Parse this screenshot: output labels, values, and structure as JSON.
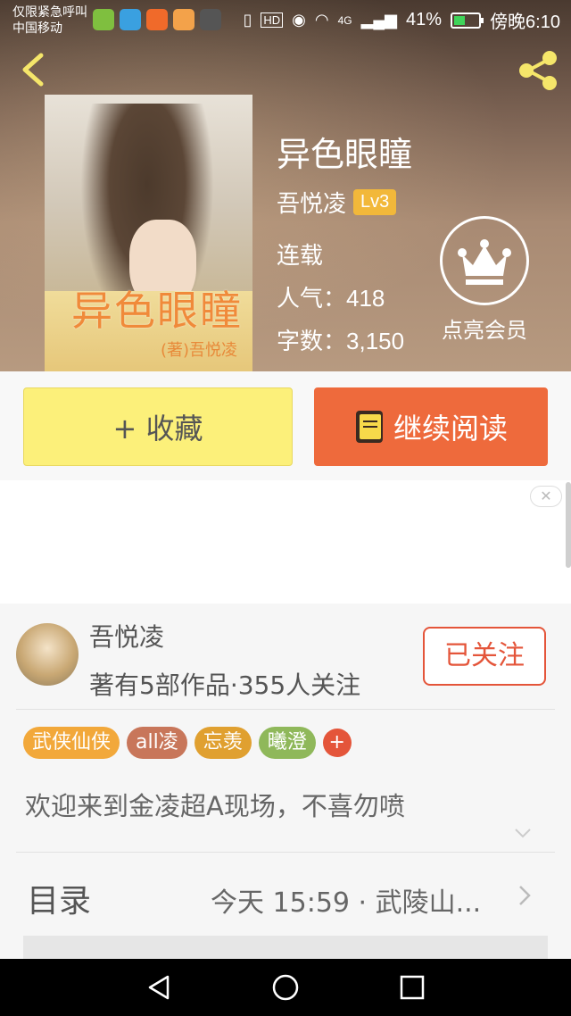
{
  "status_bar": {
    "emergency_text": "仅限紧急呼叫",
    "carrier": "中国移动",
    "network": "4G",
    "battery": "41%",
    "time": "傍晚6:10",
    "app_icon_colors": [
      "#7fbf3f",
      "#3aa0e0",
      "#f06a2a",
      "#f3a24a",
      "#555555"
    ]
  },
  "book": {
    "title": "异色眼瞳",
    "author": "吾悦凌",
    "level": "Lv3",
    "status": "连载",
    "popularity_label": "人气：",
    "popularity": "418",
    "words_label": "字数：",
    "words": "3,150",
    "cover_title": "异色眼瞳",
    "cover_author": "(著)吾悦凌"
  },
  "member": {
    "label": "点亮会员"
  },
  "actions": {
    "collect": "+ 收藏",
    "read": "继续阅读"
  },
  "author_card": {
    "name": "吾悦凌",
    "stats": "著有5部作品·355人关注",
    "follow": "已关注",
    "tags": [
      {
        "label": "武侠仙侠",
        "color": "#f2a83a"
      },
      {
        "label": "all凌",
        "color": "#c8765a"
      },
      {
        "label": "忘羡",
        "color": "#e0a030"
      },
      {
        "label": "曦澄",
        "color": "#8fb85a"
      }
    ],
    "tag_more": "+",
    "description": "欢迎来到金凌超A现场，不喜勿喷"
  },
  "catalog": {
    "label": "目录",
    "update": "今天 15:59 · 武陵山..."
  },
  "colors": {
    "accent": "#ee6a3c",
    "collect": "#fcf07a",
    "follow": "#e4553a",
    "level_badge": "#f2b83a"
  }
}
